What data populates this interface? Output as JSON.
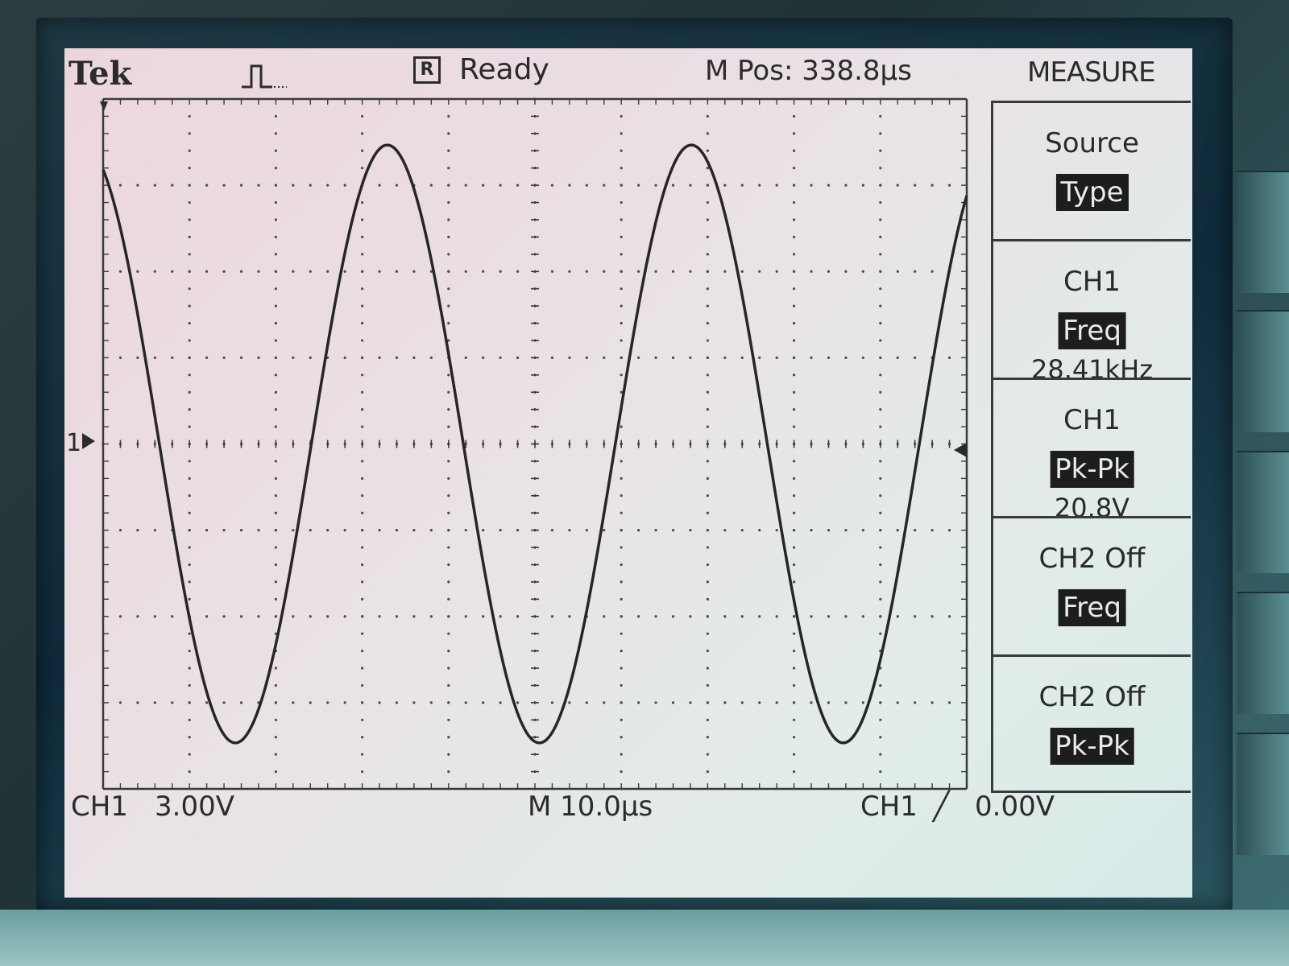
{
  "header": {
    "brand": "Tek",
    "status_badge": "R",
    "status": "Ready",
    "position_label": "M Pos: 338.8µs",
    "menu_title": "MEASURE"
  },
  "measure_menu": [
    {
      "line1": "Source",
      "highlight": "Type",
      "value": ""
    },
    {
      "line1": "CH1",
      "highlight": "Freq",
      "value": "28.41kHz"
    },
    {
      "line1": "CH1",
      "highlight": "Pk-Pk",
      "value": "20.8V"
    },
    {
      "line1": "CH2 Off",
      "highlight": "Freq",
      "value": ""
    },
    {
      "line1": "CH2 Off",
      "highlight": "Pk-Pk",
      "value": ""
    }
  ],
  "footer": {
    "ch1_label": "CH1",
    "ch1_scale": "3.00V",
    "timebase": "M 10.0µs",
    "trigger_source": "CH1",
    "trigger_slope_symbol": "╱",
    "trigger_level": "0.00V"
  },
  "channel_marker": "1",
  "waveform": {
    "channel": "CH1",
    "shape": "sine",
    "frequency_khz": 28.41,
    "peak_to_peak_v": 20.8,
    "volts_per_div": 3.0,
    "time_per_div_us": 10.0,
    "color": "#262626"
  }
}
